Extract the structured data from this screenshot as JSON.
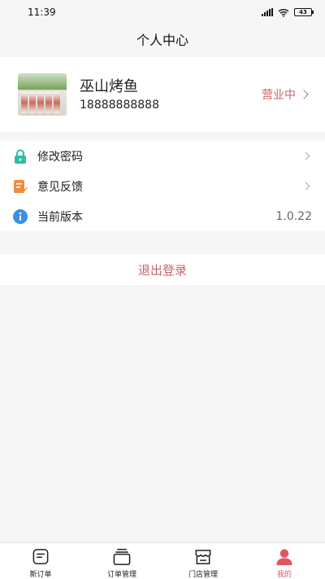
{
  "status_bar": {
    "time": "11:39",
    "battery": "43"
  },
  "nav": {
    "title": "个人中心"
  },
  "profile": {
    "store_name": "巫山烤鱼",
    "phone": "18888888888",
    "status": "营业中"
  },
  "menu": {
    "items": [
      {
        "label": "修改密码",
        "icon": "lock-icon",
        "color": "#2bc0a2"
      },
      {
        "label": "意见反馈",
        "icon": "feedback-icon",
        "color": "#f08c3f"
      },
      {
        "label": "当前版本",
        "icon": "info-icon",
        "color": "#3d8fe6",
        "value": "1.0.22"
      }
    ]
  },
  "logout": {
    "label": "退出登录"
  },
  "tabs": [
    {
      "label": "新订单",
      "icon": "new-order-icon"
    },
    {
      "label": "订单管理",
      "icon": "order-manage-icon"
    },
    {
      "label": "门店管理",
      "icon": "store-manage-icon"
    },
    {
      "label": "我的",
      "icon": "profile-icon",
      "active": true
    }
  ],
  "colors": {
    "accent": "#c9646a",
    "tab_active": "#e0585f",
    "background": "#f6f6f6"
  }
}
